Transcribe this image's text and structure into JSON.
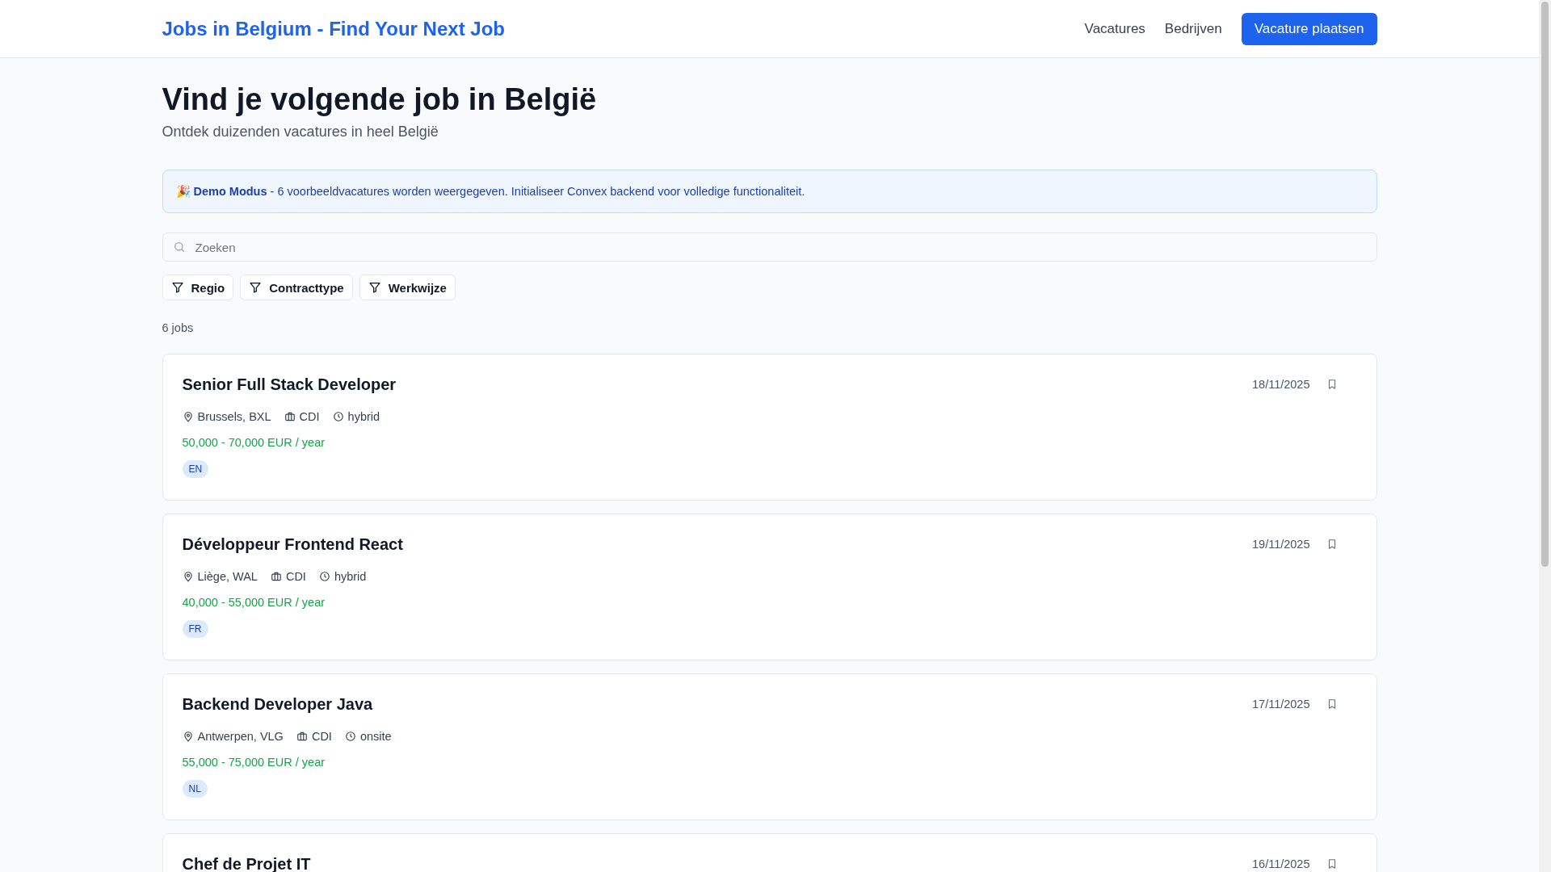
{
  "header": {
    "logo": "Jobs in Belgium - Find Your Next Job",
    "nav": [
      {
        "label": "Vacatures"
      },
      {
        "label": "Bedrijven"
      }
    ],
    "cta": "Vacature plaatsen"
  },
  "hero": {
    "title": "Vind je volgende job in België",
    "subtitle": "Ontdek duizenden vacatures in heel België"
  },
  "banner": {
    "emoji": "🎉",
    "text": "**Demo Modus** - 6 voorbeeldvacatures worden weergegeven. Initialiseer Convex backend voor volledige functionaliteit."
  },
  "search": {
    "placeholder": "Zoeken"
  },
  "filters": [
    {
      "label": "Regio"
    },
    {
      "label": "Contracttype"
    },
    {
      "label": "Werkwijze"
    }
  ],
  "count": "6 jobs",
  "jobs": [
    {
      "title": "Senior Full Stack Developer",
      "date": "18/11/2025",
      "location": "Brussels, BXL",
      "contract": "CDI",
      "mode": "hybrid",
      "salary": "50,000 - 70,000 EUR / year",
      "tags": [
        "EN"
      ]
    },
    {
      "title": "Développeur Frontend React",
      "date": "19/11/2025",
      "location": "Liège, WAL",
      "contract": "CDI",
      "mode": "hybrid",
      "salary": "40,000 - 55,000 EUR / year",
      "tags": [
        "FR"
      ]
    },
    {
      "title": "Backend Developer Java",
      "date": "17/11/2025",
      "location": "Antwerpen, VLG",
      "contract": "CDI",
      "mode": "onsite",
      "salary": "55,000 - 75,000 EUR / year",
      "tags": [
        "NL"
      ]
    },
    {
      "title": "Chef de Projet IT",
      "date": "16/11/2025"
    }
  ]
}
